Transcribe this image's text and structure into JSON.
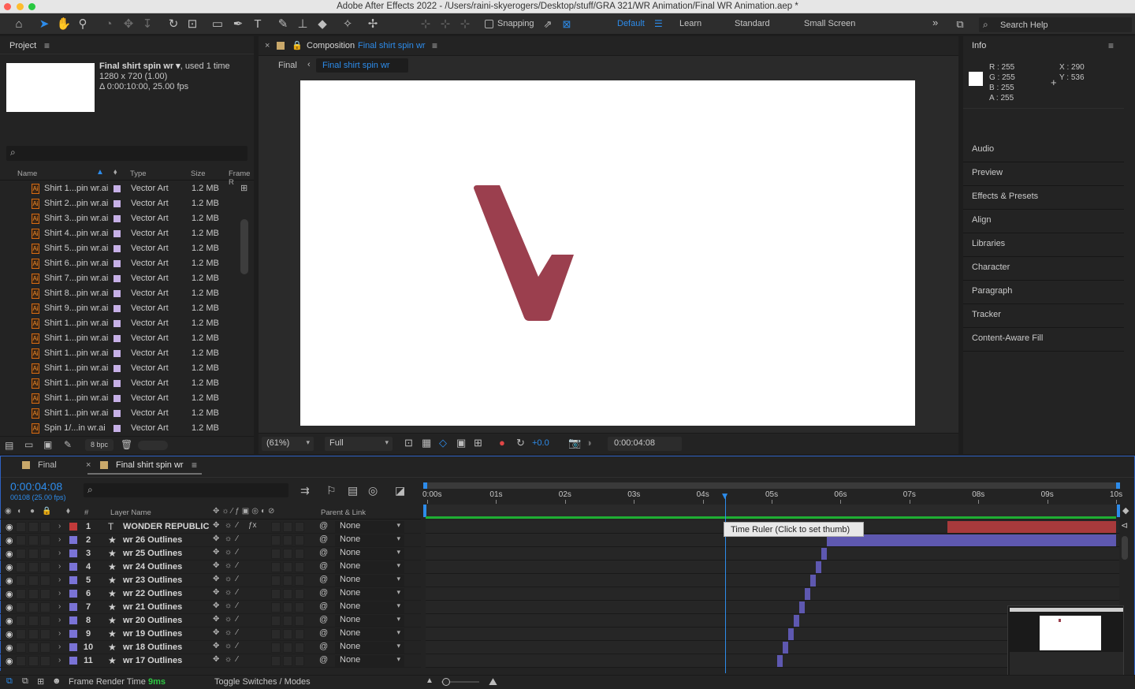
{
  "window": {
    "title": "Adobe After Effects 2022 - /Users/raini-skyerogers/Desktop/stuff/GRA 321/WR Animation/Final WR Animation.aep *"
  },
  "toolbar": {
    "snapping_label": "Snapping",
    "workspaces": [
      "Default",
      "Learn",
      "Standard",
      "Small Screen"
    ],
    "active_workspace": "Default",
    "search_placeholder": "Search Help"
  },
  "project": {
    "panel_title": "Project",
    "selected_item": "Final shirt spin wr ▾",
    "selected_used": ", used 1 time",
    "selected_dims": "1280 x 720 (1.00)",
    "selected_duration": "Δ 0:00:10:00, 25.00 fps",
    "columns": {
      "name": "Name",
      "type": "Type",
      "size": "Size",
      "frame": "Frame R"
    },
    "items": [
      {
        "name": "Shirt 1...pin wr.ai",
        "type": "Vector Art",
        "size": "1.2 MB"
      },
      {
        "name": "Shirt 2...pin wr.ai",
        "type": "Vector Art",
        "size": "1.2 MB"
      },
      {
        "name": "Shirt 3...pin wr.ai",
        "type": "Vector Art",
        "size": "1.2 MB"
      },
      {
        "name": "Shirt 4...pin wr.ai",
        "type": "Vector Art",
        "size": "1.2 MB"
      },
      {
        "name": "Shirt 5...pin wr.ai",
        "type": "Vector Art",
        "size": "1.2 MB"
      },
      {
        "name": "Shirt 6...pin wr.ai",
        "type": "Vector Art",
        "size": "1.2 MB"
      },
      {
        "name": "Shirt 7...pin wr.ai",
        "type": "Vector Art",
        "size": "1.2 MB"
      },
      {
        "name": "Shirt 8...pin wr.ai",
        "type": "Vector Art",
        "size": "1.2 MB"
      },
      {
        "name": "Shirt 9...pin wr.ai",
        "type": "Vector Art",
        "size": "1.2 MB"
      },
      {
        "name": "Shirt 1...pin wr.ai",
        "type": "Vector Art",
        "size": "1.2 MB"
      },
      {
        "name": "Shirt 1...pin wr.ai",
        "type": "Vector Art",
        "size": "1.2 MB"
      },
      {
        "name": "Shirt 1...pin wr.ai",
        "type": "Vector Art",
        "size": "1.2 MB"
      },
      {
        "name": "Shirt 1...pin wr.ai",
        "type": "Vector Art",
        "size": "1.2 MB"
      },
      {
        "name": "Shirt 1...pin wr.ai",
        "type": "Vector Art",
        "size": "1.2 MB"
      },
      {
        "name": "Shirt 1...pin wr.ai",
        "type": "Vector Art",
        "size": "1.2 MB"
      },
      {
        "name": "Shirt 1...pin wr.ai",
        "type": "Vector Art",
        "size": "1.2 MB"
      },
      {
        "name": "Spin 1/...in wr.ai",
        "type": "Vector Art",
        "size": "1.2 MB"
      }
    ],
    "bpc": "8 bpc"
  },
  "composition": {
    "tab_prefix": "Composition",
    "tab_name": "Final shirt spin wr",
    "breadcrumb_parent": "Final",
    "breadcrumb_current": "Final shirt spin wr",
    "zoom": "(61%)",
    "resolution": "Full",
    "exposure": "+0.0",
    "timecode": "0:00:04:08",
    "shape_color": "#9b3f4e"
  },
  "info": {
    "title": "Info",
    "r": "R :  255",
    "g": "G :  255",
    "b": "B :  255",
    "a": "A :  255",
    "x": "X :  290",
    "y": "Y :  536",
    "panels": [
      "Audio",
      "Preview",
      "Effects & Presets",
      "Align",
      "Libraries",
      "Character",
      "Paragraph",
      "Tracker",
      "Content-Aware Fill"
    ]
  },
  "timeline": {
    "tabs": [
      "Final",
      "Final shirt spin wr"
    ],
    "timecode": "0:00:04:08",
    "timecode_sub": "00108 (25.00 fps)",
    "col_layer_name": "Layer Name",
    "col_parent": "Parent & Link",
    "ruler": [
      "0:00s",
      "01s",
      "02s",
      "03s",
      "04s",
      "05s",
      "06s",
      "07s",
      "08s",
      "09s",
      "10s"
    ],
    "tooltip": "Time Ruler (Click to set thumb)",
    "layers": [
      {
        "num": "1",
        "name": "WONDER REPUBLIC",
        "type": "text",
        "color": "#c23a3a",
        "parent": "None",
        "bar_start": 7.55,
        "bar_end": 10,
        "bar_color": "#a83a3c"
      },
      {
        "num": "2",
        "name": "wr 26 Outlines",
        "type": "shape",
        "color": "#7a73d6",
        "parent": "None",
        "bar_start": 5.8,
        "bar_end": 10,
        "bar_color": "#5e58b0"
      },
      {
        "num": "3",
        "name": "wr 25 Outlines",
        "type": "shape",
        "color": "#7a73d6",
        "parent": "None",
        "bar_start": 5.72,
        "bar_end": 5.8,
        "bar_color": "#5e58b0"
      },
      {
        "num": "4",
        "name": "wr 24 Outlines",
        "type": "shape",
        "color": "#7a73d6",
        "parent": "None",
        "bar_start": 5.64,
        "bar_end": 5.72,
        "bar_color": "#5e58b0"
      },
      {
        "num": "5",
        "name": "wr 23 Outlines",
        "type": "shape",
        "color": "#7a73d6",
        "parent": "None",
        "bar_start": 5.56,
        "bar_end": 5.64,
        "bar_color": "#5e58b0"
      },
      {
        "num": "6",
        "name": "wr 22 Outlines",
        "type": "shape",
        "color": "#7a73d6",
        "parent": "None",
        "bar_start": 5.48,
        "bar_end": 5.56,
        "bar_color": "#5e58b0"
      },
      {
        "num": "7",
        "name": "wr 21 Outlines",
        "type": "shape",
        "color": "#7a73d6",
        "parent": "None",
        "bar_start": 5.4,
        "bar_end": 5.48,
        "bar_color": "#5e58b0"
      },
      {
        "num": "8",
        "name": "wr 20 Outlines",
        "type": "shape",
        "color": "#7a73d6",
        "parent": "None",
        "bar_start": 5.32,
        "bar_end": 5.4,
        "bar_color": "#5e58b0"
      },
      {
        "num": "9",
        "name": "wr 19 Outlines",
        "type": "shape",
        "color": "#7a73d6",
        "parent": "None",
        "bar_start": 5.24,
        "bar_end": 5.32,
        "bar_color": "#5e58b0"
      },
      {
        "num": "10",
        "name": "wr 18 Outlines",
        "type": "shape",
        "color": "#7a73d6",
        "parent": "None",
        "bar_start": 5.16,
        "bar_end": 5.24,
        "bar_color": "#5e58b0"
      },
      {
        "num": "11",
        "name": "wr 17 Outlines",
        "type": "shape",
        "color": "#7a73d6",
        "parent": "None",
        "bar_start": 5.08,
        "bar_end": 5.16,
        "bar_color": "#5e58b0"
      }
    ],
    "playhead_seconds": 4.32,
    "footer_render_label": "Frame Render Time",
    "footer_render_value": "9ms",
    "footer_toggle": "Toggle Switches / Modes"
  }
}
